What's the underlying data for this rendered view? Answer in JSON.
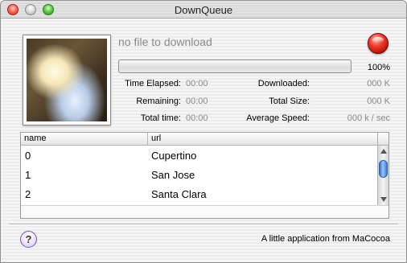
{
  "window": {
    "title": "DownQueue"
  },
  "status": {
    "message": "no file to download",
    "progress_percent": 0,
    "progress_label": "100%"
  },
  "stats": {
    "time_elapsed_label": "Time Elapsed:",
    "time_elapsed": "00:00",
    "remaining_label": "Remaining:",
    "remaining": "00:00",
    "total_time_label": "Total time:",
    "total_time": "00:00",
    "downloaded_label": "Downloaded:",
    "downloaded": "000 K",
    "total_size_label": "Total Size:",
    "total_size": "000 K",
    "avg_speed_label": "Average Speed:",
    "avg_speed": "000 k / sec"
  },
  "table": {
    "columns": [
      "name",
      "url"
    ],
    "rows": [
      {
        "name": "0",
        "url": "Cupertino"
      },
      {
        "name": "1",
        "url": "San Jose"
      },
      {
        "name": "2",
        "url": "Santa Clara"
      }
    ]
  },
  "footer": {
    "help_label": "?",
    "credit": "A little application from MaCocoa"
  },
  "colors": {
    "stop_button": "#d42414",
    "scroll_thumb": "#3a7ad6",
    "muted_text": "#8a8a8a"
  }
}
